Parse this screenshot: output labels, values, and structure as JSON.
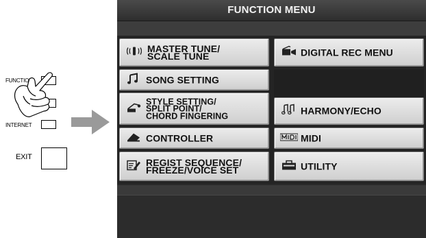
{
  "panel": {
    "function_label": "FUNCTION",
    "internet_label": "INTERNET",
    "exit_label": "EXIT"
  },
  "screen": {
    "title": "FUNCTION MENU"
  },
  "menu": {
    "left": [
      {
        "label": "MASTER TUNE/\nSCALE TUNE",
        "icon": "tuning-fork-icon"
      },
      {
        "label": "SONG SETTING",
        "icon": "music-note-icon"
      },
      {
        "label": "STYLE SETTING/\nSPLIT POINT/\nCHORD FINGERING",
        "icon": "style-icon"
      },
      {
        "label": "CONTROLLER",
        "icon": "pedal-icon"
      },
      {
        "label": "REGIST SEQUENCE/\nFREEZE/VOICE SET",
        "icon": "regist-icon"
      }
    ],
    "right": [
      {
        "label": "DIGITAL REC MENU",
        "icon": "digital-rec-icon"
      },
      {
        "label": "HARMONY/ECHO",
        "icon": "harmony-icon"
      },
      {
        "label": "MIDI",
        "icon": "midi-icon"
      },
      {
        "label": "UTILITY",
        "icon": "toolbox-icon"
      }
    ]
  }
}
